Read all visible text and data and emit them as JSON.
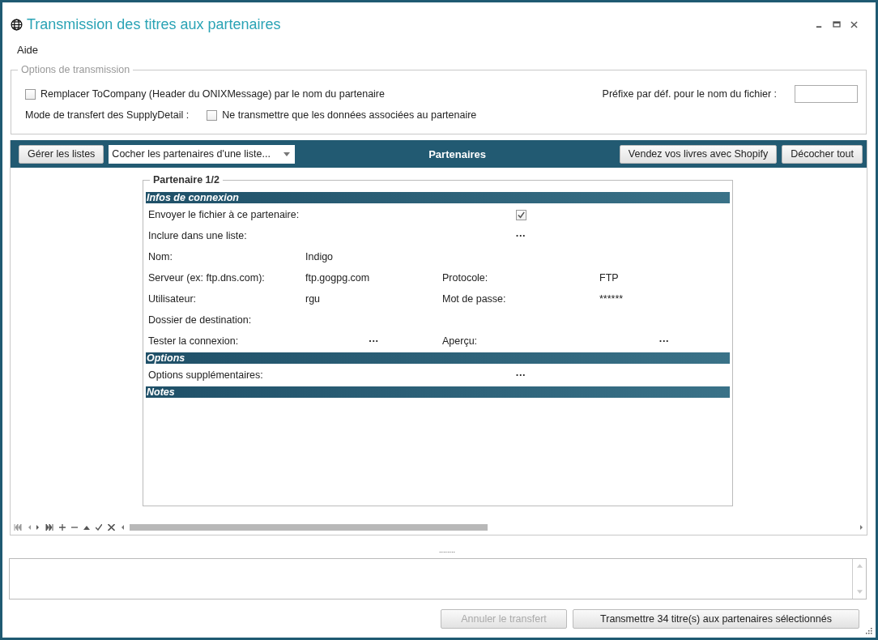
{
  "window": {
    "title": "Transmission des titres aux partenaires"
  },
  "menu": [
    "Aide"
  ],
  "options": {
    "legend": "Options de transmission",
    "replace": {
      "label": "Remplacer ToCompany (Header du ONIXMessage) par le nom du partenaire",
      "checked": false
    },
    "prefix_label": "Préfixe par déf. pour le nom du fichier :",
    "mode_label": "Mode de transfert des SupplyDetail :",
    "mode": {
      "label": "Ne transmettre que les données associées au partenaire",
      "checked": false
    }
  },
  "toolbar": {
    "manage_button": "Gérer les listes",
    "list_dropdown": "Cocher les partenaires d'une liste...",
    "title": "Partenaires",
    "shopify_button": "Vendez vos livres avec Shopify",
    "uncheck_button": "Décocher tout"
  },
  "partner": {
    "legend": "Partenaire 1/2",
    "sections": [
      {
        "title": "Infos de connexion",
        "rows": [
          {
            "items": [
              {
                "kind": "check",
                "label": "Envoyer le fichier à ce partenaire:",
                "checked": true
              }
            ]
          },
          {
            "items": [
              {
                "kind": "action",
                "label": "Inclure dans une liste:",
                "value": "···"
              }
            ]
          },
          {
            "items": [
              {
                "kind": "text",
                "label": "Nom:",
                "value": "Indigo"
              }
            ]
          },
          {
            "items": [
              {
                "kind": "text",
                "label": "Serveur (ex: ftp.dns.com):",
                "value": "ftp.gogpg.com"
              },
              {
                "kind": "text",
                "label": "Protocole:",
                "value": "FTP"
              }
            ]
          },
          {
            "items": [
              {
                "kind": "text",
                "label": "Utilisateur:",
                "value": "rgu"
              },
              {
                "kind": "text",
                "label": "Mot de passe:",
                "value": "******"
              }
            ]
          },
          {
            "items": [
              {
                "kind": "text",
                "label": "Dossier de destination:"
              }
            ]
          },
          {
            "items": [
              {
                "kind": "action",
                "label": "Tester la connexion:",
                "value": "···"
              },
              {
                "kind": "action",
                "label": "Aperçu:",
                "value": "···"
              }
            ]
          }
        ]
      },
      {
        "title": "Options",
        "rows": [
          {
            "items": [
              {
                "kind": "action",
                "label": "Options supplémentaires:",
                "value": "···"
              }
            ]
          }
        ]
      },
      {
        "title": "Notes"
      }
    ]
  },
  "footer": {
    "splitter": "........",
    "cancel_button": {
      "label": "Annuler le transfert",
      "disabled": true
    },
    "send_button": {
      "label": "Transmettre 34 titre(s) aux partenaires sélectionnés",
      "disabled": false
    }
  }
}
